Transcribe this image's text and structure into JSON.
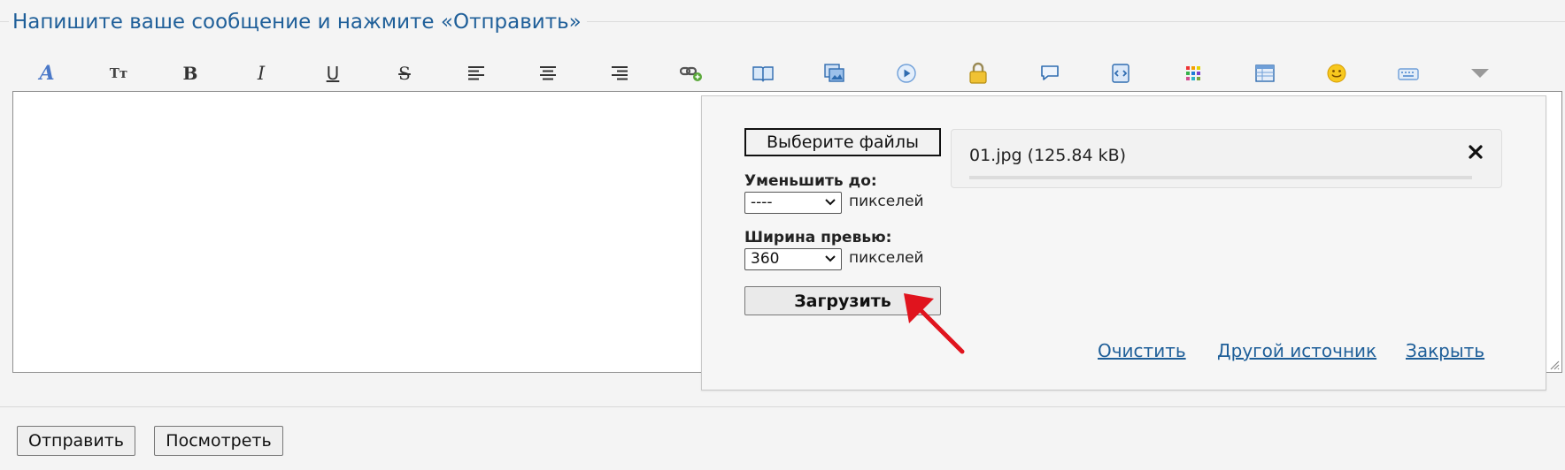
{
  "legend": {
    "title": "Напишите ваше сообщение и нажмите «Отправить»"
  },
  "toolbar": {
    "buttons": [
      {
        "name": "font-color-icon"
      },
      {
        "name": "font-size-icon",
        "glyph": "Tт"
      },
      {
        "name": "bold-icon",
        "glyph": "B"
      },
      {
        "name": "italic-icon",
        "glyph": "I"
      },
      {
        "name": "underline-icon",
        "glyph": "U"
      },
      {
        "name": "strikethrough-icon",
        "glyph": "S"
      },
      {
        "name": "align-left-icon"
      },
      {
        "name": "align-center-icon"
      },
      {
        "name": "align-right-icon"
      },
      {
        "name": "insert-link-icon"
      },
      {
        "name": "book-icon"
      },
      {
        "name": "insert-image-icon"
      },
      {
        "name": "video-play-icon"
      },
      {
        "name": "lock-icon"
      },
      {
        "name": "speech-bubble-icon"
      },
      {
        "name": "code-icon"
      },
      {
        "name": "color-palette-icon"
      },
      {
        "name": "table-icon"
      },
      {
        "name": "smiley-icon"
      },
      {
        "name": "keyboard-icon"
      },
      {
        "name": "more-dropdown-icon"
      }
    ]
  },
  "upload": {
    "choose_files_label": "Выберите файлы",
    "reduce_label": "Уменьшить до:",
    "reduce_value": "----",
    "pixels_label": "пикселей",
    "preview_width_label": "Ширина превью:",
    "preview_width_value": "360",
    "upload_button_label": "Загрузить",
    "file": {
      "name": "01.jpg (125.84 kB)",
      "progress": 0.0
    },
    "links": {
      "clear": "Очистить",
      "other_source": "Другой источник",
      "close": "Закрыть"
    }
  },
  "footer": {
    "send_label": "Отправить",
    "preview_label": "Посмотреть"
  },
  "colors": {
    "accent": "#1f5f99",
    "arrow": "#e0141e"
  }
}
